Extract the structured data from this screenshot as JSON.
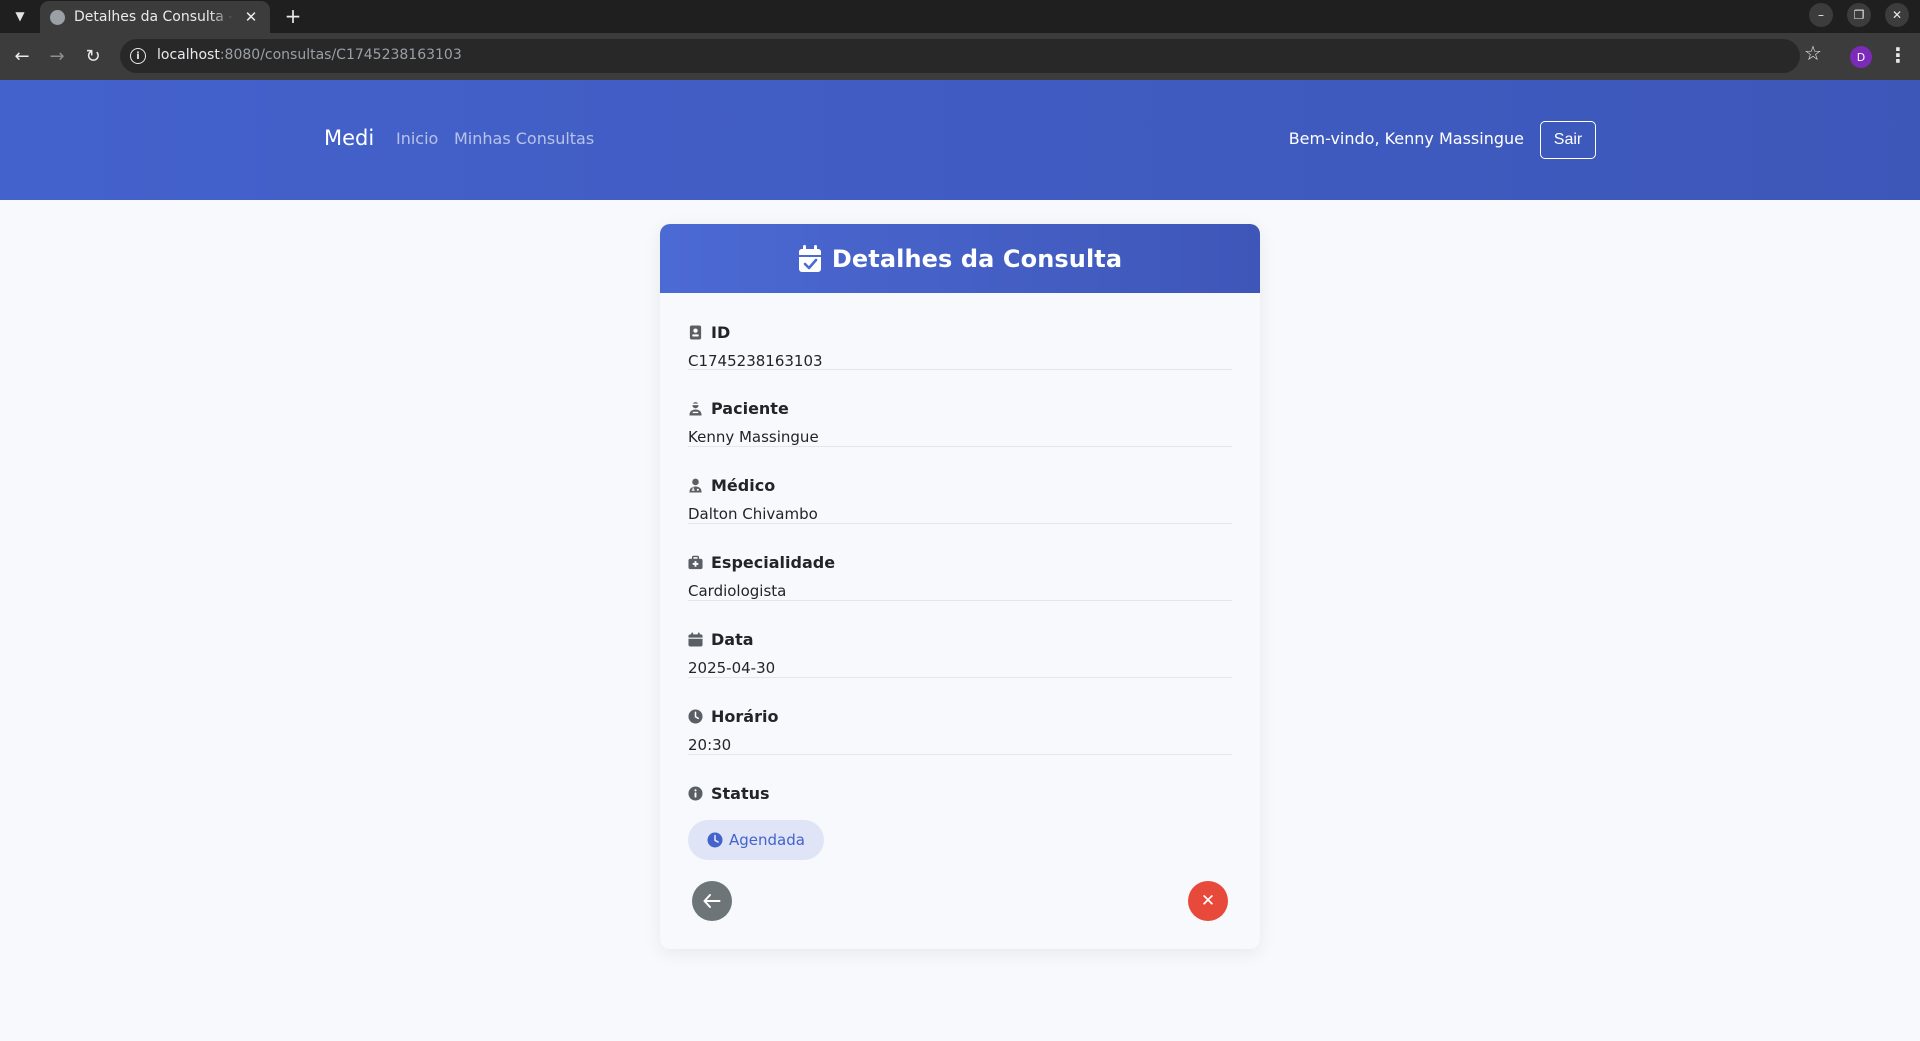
{
  "browser": {
    "tab_title": "Detalhes da Consulta - Cl",
    "tab_close": "✕",
    "new_tab": "+",
    "url_host": "localhost",
    "url_rest": ":8080/consultas/C1745238163103",
    "profile_initial": "D"
  },
  "navbar": {
    "brand": "Medi",
    "links": [
      "Inicio",
      "Minhas Consultas"
    ],
    "welcome": "Bem-vindo, Kenny Massingue",
    "logout_label": "Sair"
  },
  "card": {
    "title": "Detalhes da Consulta",
    "fields": [
      {
        "label": "ID",
        "value": "C1745238163103",
        "icon": "id-badge-icon"
      },
      {
        "label": "Paciente",
        "value": "Kenny Massingue",
        "icon": "user-injured-icon"
      },
      {
        "label": "Médico",
        "value": "Dalton Chivambo",
        "icon": "user-doctor-icon"
      },
      {
        "label": "Especialidade",
        "value": "Cardiologista",
        "icon": "briefcase-medical-icon"
      },
      {
        "label": "Data",
        "value": "2025-04-30",
        "icon": "calendar-icon"
      },
      {
        "label": "Horário",
        "value": "20:30",
        "icon": "clock-icon"
      }
    ],
    "status": {
      "label": "Status",
      "value": "Agendada",
      "icon": "info-circle-icon"
    },
    "back_button_icon": "arrow-left-icon",
    "cancel_button_icon": "x-icon",
    "cancel_glyph": "✕"
  },
  "colors": {
    "navbar": "#4462cc",
    "card_header": "#4c6ad4",
    "status_badge_bg": "#dfe4f6",
    "status_badge_text": "#4462cc",
    "back_button": "#6e7579",
    "cancel_button": "#e74a3b"
  }
}
